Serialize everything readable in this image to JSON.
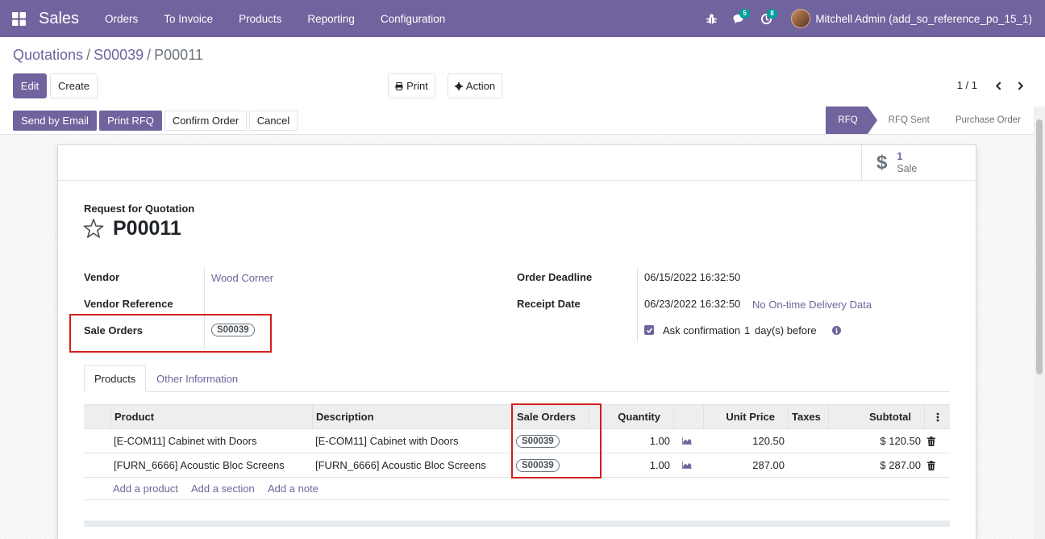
{
  "navbar": {
    "app_name": "Sales",
    "menu": [
      "Orders",
      "To Invoice",
      "Products",
      "Reporting",
      "Configuration"
    ],
    "messages_count": "5",
    "activities_count": "8",
    "user": "Mitchell Admin (add_so_reference_po_15_1)"
  },
  "breadcrumb": {
    "items": [
      "Quotations",
      "S00039"
    ],
    "current": "P00011"
  },
  "control": {
    "edit": "Edit",
    "create": "Create",
    "print": "Print",
    "action": "Action",
    "pager": "1 / 1"
  },
  "statusbar": {
    "buttons": [
      "Send by Email",
      "Print RFQ",
      "Confirm Order",
      "Cancel"
    ],
    "stages": [
      "RFQ",
      "RFQ Sent",
      "Purchase Order"
    ],
    "current_stage": "RFQ"
  },
  "smart_button": {
    "value": "1",
    "label": "Sale"
  },
  "document": {
    "type_label": "Request for Quotation",
    "name": "P00011"
  },
  "fields": {
    "vendor_label": "Vendor",
    "vendor": "Wood Corner",
    "vendor_ref_label": "Vendor Reference",
    "sale_orders_label": "Sale Orders",
    "sale_order_tag": "S00039",
    "deadline_label": "Order Deadline",
    "deadline": "06/15/2022 16:32:50",
    "receipt_label": "Receipt Date",
    "receipt": "06/23/2022 16:32:50",
    "ontime": "No On-time Delivery Data",
    "ask_confirmation": "Ask confirmation",
    "ask_days": "1",
    "ask_suffix": "day(s) before"
  },
  "tabs": [
    "Products",
    "Other Information"
  ],
  "table": {
    "headers": {
      "product": "Product",
      "description": "Description",
      "sale_orders": "Sale Orders",
      "quantity": "Quantity",
      "unit_price": "Unit Price",
      "taxes": "Taxes",
      "subtotal": "Subtotal"
    },
    "rows": [
      {
        "product": "[E-COM11] Cabinet with Doors",
        "description": "[E-COM11] Cabinet with Doors",
        "sale_order": "S00039",
        "quantity": "1.00",
        "unit_price": "120.50",
        "subtotal": "$ 120.50"
      },
      {
        "product": "[FURN_6666] Acoustic Bloc Screens",
        "description": "[FURN_6666] Acoustic Bloc Screens",
        "sale_order": "S00039",
        "quantity": "1.00",
        "unit_price": "287.00",
        "subtotal": "$ 287.00"
      }
    ],
    "add_links": [
      "Add a product",
      "Add a section",
      "Add a note"
    ]
  },
  "colors": {
    "brand": "#71639e",
    "highlight": "#d61c1c",
    "badge": "#00a09d"
  }
}
